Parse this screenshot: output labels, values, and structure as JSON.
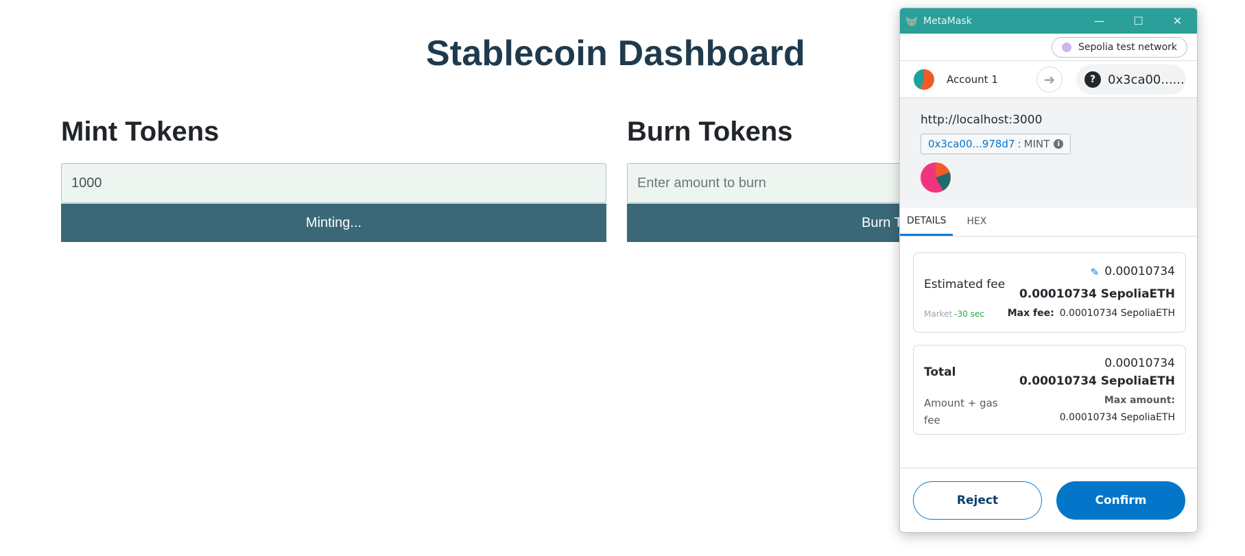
{
  "dashboard": {
    "title": "Stablecoin Dashboard",
    "mint": {
      "heading": "Mint Tokens",
      "value": "1000",
      "placeholder": "",
      "button": "Minting..."
    },
    "burn": {
      "heading": "Burn Tokens",
      "value": "",
      "placeholder": "Enter amount to burn",
      "button": "Burn Tokens"
    }
  },
  "metamask": {
    "window_title": "MetaMask",
    "network": "Sepolia test network",
    "account_name": "Account 1",
    "to_address": "0x3ca00......",
    "origin": "http://localhost:3000",
    "contract_address": "0x3ca00...978d7",
    "method_separator": ":",
    "method": "MINT",
    "tabs": [
      "DETAILS",
      "HEX"
    ],
    "fee": {
      "label": "Estimated fee",
      "amount": "0.00010734",
      "amount_eth": "0.00010734 SepoliaETH",
      "speed": "Market",
      "time": "-30 sec",
      "max_label": "Max fee:",
      "max_value": "0.00010734 SepoliaETH"
    },
    "total": {
      "label": "Total",
      "amount": "0.00010734",
      "amount_eth": "0.00010734 SepoliaETH",
      "sub_label": "Amount + gas fee",
      "max_label": "Max amount:",
      "max_value": "0.00010734 SepoliaETH"
    },
    "reject": "Reject",
    "confirm": "Confirm"
  },
  "colors": {
    "accent": "#0376c9",
    "titlebar": "#2b9f99",
    "dashboard_button": "#3a6878",
    "title": "#1f3a4d"
  }
}
